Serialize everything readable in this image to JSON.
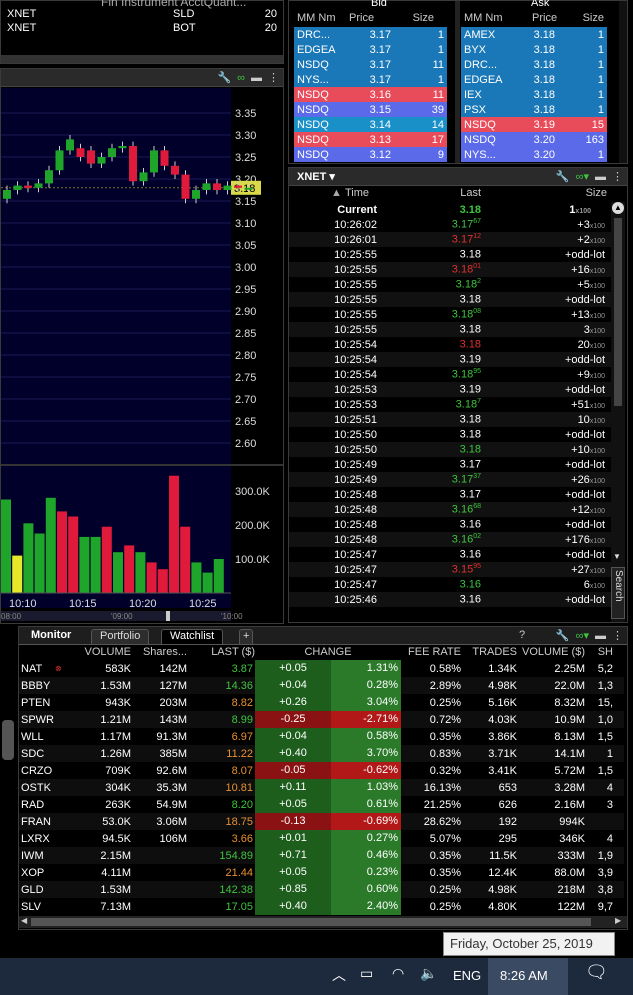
{
  "top_left": {
    "header": "Fin Instrument AcctQuant...",
    "rows": [
      {
        "sym": "XNET",
        "side": "SLD",
        "qty": "20"
      },
      {
        "sym": "XNET",
        "side": "BOT",
        "qty": "20"
      }
    ]
  },
  "book": {
    "bid_label": "Bid",
    "ask_label": "Ask",
    "col_mm": "MM Nm",
    "col_price": "Price",
    "col_size": "Size",
    "bids": [
      {
        "mm": "DRC...",
        "price": "3.17",
        "size": "1",
        "c": "#1a78b8"
      },
      {
        "mm": "EDGEA",
        "price": "3.17",
        "size": "1",
        "c": "#1a78b8"
      },
      {
        "mm": "NSDQ",
        "price": "3.17",
        "size": "11",
        "c": "#1a78b8"
      },
      {
        "mm": "NYS...",
        "price": "3.17",
        "size": "1",
        "c": "#1a78b8"
      },
      {
        "mm": "NSDQ",
        "price": "3.16",
        "size": "11",
        "c": "#e84b5a"
      },
      {
        "mm": "NSDQ",
        "price": "3.15",
        "size": "39",
        "c": "#5a6ae8"
      },
      {
        "mm": "NSDQ",
        "price": "3.14",
        "size": "14",
        "c": "#1a90c8"
      },
      {
        "mm": "NSDQ",
        "price": "3.13",
        "size": "17",
        "c": "#e84b5a"
      },
      {
        "mm": "NSDQ",
        "price": "3.12",
        "size": "9",
        "c": "#5a6ae8"
      }
    ],
    "asks": [
      {
        "mm": "AMEX",
        "price": "3.18",
        "size": "1",
        "c": "#1a78b8"
      },
      {
        "mm": "BYX",
        "price": "3.18",
        "size": "1",
        "c": "#1a78b8"
      },
      {
        "mm": "DRC...",
        "price": "3.18",
        "size": "1",
        "c": "#1a78b8"
      },
      {
        "mm": "EDGEA",
        "price": "3.18",
        "size": "1",
        "c": "#1a78b8"
      },
      {
        "mm": "IEX",
        "price": "3.18",
        "size": "1",
        "c": "#1a78b8"
      },
      {
        "mm": "PSX",
        "price": "3.18",
        "size": "1",
        "c": "#1a78b8"
      },
      {
        "mm": "NSDQ",
        "price": "3.19",
        "size": "15",
        "c": "#e84b5a"
      },
      {
        "mm": "NSDQ",
        "price": "3.20",
        "size": "163",
        "c": "#5a6ae8"
      },
      {
        "mm": "NYS...",
        "price": "3.20",
        "size": "1",
        "c": "#5a6ae8"
      }
    ]
  },
  "chart": {
    "yticks": [
      "3.35",
      "3.30",
      "3.25",
      "3.20",
      "3.15",
      "3.10",
      "3.05",
      "3.00",
      "2.95",
      "2.90",
      "2.85",
      "2.80",
      "2.75",
      "2.70",
      "2.65",
      "2.60"
    ],
    "last_price": "3.18",
    "vticks": [
      "300.0K",
      "200.0K",
      "100.0K"
    ],
    "xticks": [
      "10:10",
      "10:15",
      "10:20",
      "10:25"
    ],
    "xsub": [
      "08:00",
      "'09:00",
      "'10:00"
    ],
    "candles": [
      {
        "o": 3.155,
        "c": 3.175
      },
      {
        "o": 3.175,
        "c": 3.185
      },
      {
        "o": 3.185,
        "c": 3.18
      },
      {
        "o": 3.18,
        "c": 3.19
      },
      {
        "o": 3.19,
        "c": 3.22
      },
      {
        "o": 3.22,
        "c": 3.265
      },
      {
        "o": 3.265,
        "c": 3.29
      },
      {
        "o": 3.27,
        "c": 3.25
      },
      {
        "o": 3.265,
        "c": 3.235
      },
      {
        "o": 3.235,
        "c": 3.25
      },
      {
        "o": 3.25,
        "c": 3.27
      },
      {
        "o": 3.27,
        "c": 3.275
      },
      {
        "o": 3.275,
        "c": 3.195
      },
      {
        "o": 3.195,
        "c": 3.215
      },
      {
        "o": 3.215,
        "c": 3.265
      },
      {
        "o": 3.265,
        "c": 3.23
      },
      {
        "o": 3.23,
        "c": 3.21
      },
      {
        "o": 3.21,
        "c": 3.155
      },
      {
        "o": 3.155,
        "c": 3.175
      },
      {
        "o": 3.175,
        "c": 3.19
      },
      {
        "o": 3.19,
        "c": 3.175
      },
      {
        "o": 3.175,
        "c": 3.185
      },
      {
        "o": 3.185,
        "c": 3.18
      },
      {
        "o": 3.18,
        "c": 3.18
      }
    ],
    "volumes": [
      {
        "v": 275,
        "col": "g"
      },
      {
        "v": 110,
        "col": "y"
      },
      {
        "v": 205,
        "col": "g"
      },
      {
        "v": 175,
        "col": "g"
      },
      {
        "v": 280,
        "col": "g"
      },
      {
        "v": 240,
        "col": "r"
      },
      {
        "v": 225,
        "col": "r"
      },
      {
        "v": 165,
        "col": "g"
      },
      {
        "v": 165,
        "col": "g"
      },
      {
        "v": 195,
        "col": "r"
      },
      {
        "v": 120,
        "col": "g"
      },
      {
        "v": 140,
        "col": "r"
      },
      {
        "v": 120,
        "col": "g"
      },
      {
        "v": 90,
        "col": "r"
      },
      {
        "v": 70,
        "col": "r"
      },
      {
        "v": 345,
        "col": "r"
      },
      {
        "v": 195,
        "col": "r"
      },
      {
        "v": 90,
        "col": "g"
      },
      {
        "v": 60,
        "col": "g"
      },
      {
        "v": 100,
        "col": "g"
      }
    ]
  },
  "ts": {
    "symbol": "XNET",
    "col_time": "Time",
    "col_last": "Last",
    "col_size": "Size",
    "current_label": "Current",
    "current_last": "3.18",
    "current_size": "1",
    "x100": "x100",
    "search": "Search",
    "rows": [
      [
        "10:26:02",
        "3.17",
        "67",
        "g",
        "+3"
      ],
      [
        "10:26:01",
        "3.17",
        "12",
        "r",
        "+2"
      ],
      [
        "10:25:55",
        "3.18",
        "",
        "w",
        "+odd-lot"
      ],
      [
        "10:25:55",
        "3.18",
        "01",
        "r",
        "+16"
      ],
      [
        "10:25:55",
        "3.18",
        "2",
        "g",
        "+5"
      ],
      [
        "10:25:55",
        "3.18",
        "",
        "w",
        "+odd-lot"
      ],
      [
        "10:25:55",
        "3.18",
        "08",
        "g",
        "+13"
      ],
      [
        "10:25:55",
        "3.18",
        "",
        "w",
        "3"
      ],
      [
        "10:25:54",
        "3.18",
        "",
        "r",
        "20"
      ],
      [
        "10:25:54",
        "3.19",
        "",
        "w",
        "+odd-lot"
      ],
      [
        "10:25:54",
        "3.18",
        "95",
        "g",
        "+9"
      ],
      [
        "10:25:53",
        "3.19",
        "",
        "w",
        "+odd-lot"
      ],
      [
        "10:25:53",
        "3.18",
        "7",
        "g",
        "+51"
      ],
      [
        "10:25:51",
        "3.18",
        "",
        "w",
        "10"
      ],
      [
        "10:25:50",
        "3.18",
        "",
        "w",
        "+odd-lot"
      ],
      [
        "10:25:50",
        "3.18",
        "",
        "g",
        "+10"
      ],
      [
        "10:25:49",
        "3.17",
        "",
        "w",
        "+odd-lot"
      ],
      [
        "10:25:49",
        "3.17",
        "37",
        "g",
        "+26"
      ],
      [
        "10:25:48",
        "3.17",
        "",
        "w",
        "+odd-lot"
      ],
      [
        "10:25:48",
        "3.16",
        "68",
        "g",
        "+12"
      ],
      [
        "10:25:48",
        "3.16",
        "",
        "w",
        "+odd-lot"
      ],
      [
        "10:25:48",
        "3.16",
        "02",
        "g",
        "+176"
      ],
      [
        "10:25:47",
        "3.16",
        "",
        "w",
        "+odd-lot"
      ],
      [
        "10:25:47",
        "3.15",
        "95",
        "r",
        "+27"
      ],
      [
        "10:25:47",
        "3.16",
        "",
        "g",
        "6"
      ],
      [
        "10:25:46",
        "3.16",
        "",
        "w",
        "+odd-lot"
      ]
    ]
  },
  "monitor": {
    "tabs": [
      "Monitor",
      "Portfolio",
      "Watchlist",
      "+"
    ],
    "help": "?",
    "headers": [
      "VOLUME",
      "Shares...",
      "LAST ($)",
      "CHANGE",
      "",
      "FEE RATE",
      "TRADES",
      "VOLUME ($)",
      "SH"
    ],
    "rows": [
      [
        "NAT",
        "583K",
        "142M",
        "3.87",
        "g",
        "+0.05",
        "1.31%",
        "0.58%",
        "1.34K",
        "2.25M",
        "5,2",
        "g"
      ],
      [
        "BBBY",
        "1.53M",
        "127M",
        "14.36",
        "g",
        "+0.04",
        "0.28%",
        "2.89%",
        "4.98K",
        "22.0M",
        "1,3",
        "g"
      ],
      [
        "PTEN",
        "943K",
        "203M",
        "8.82",
        "o",
        "+0.26",
        "3.04%",
        "0.25%",
        "5.16K",
        "8.32M",
        "15,",
        "g"
      ],
      [
        "SPWR",
        "1.21M",
        "143M",
        "8.99",
        "g",
        "-0.25",
        "-2.71%",
        "0.72%",
        "4.03K",
        "10.9M",
        "1,0",
        "r"
      ],
      [
        "WLL",
        "1.17M",
        "91.3M",
        "6.97",
        "o",
        "+0.04",
        "0.58%",
        "0.35%",
        "3.86K",
        "8.13M",
        "1,5",
        "g"
      ],
      [
        "SDC",
        "1.26M",
        "385M",
        "11.22",
        "o",
        "+0.40",
        "3.70%",
        "0.83%",
        "3.71K",
        "14.1M",
        "1",
        "g"
      ],
      [
        "CRZO",
        "709K",
        "92.6M",
        "8.07",
        "o",
        "-0.05",
        "-0.62%",
        "0.32%",
        "3.41K",
        "5.72M",
        "1,5",
        "r"
      ],
      [
        "OSTK",
        "304K",
        "35.3M",
        "10.81",
        "o",
        "+0.11",
        "1.03%",
        "16.13%",
        "653",
        "3.28M",
        "4",
        "g"
      ],
      [
        "RAD",
        "263K",
        "54.9M",
        "8.20",
        "g",
        "+0.05",
        "0.61%",
        "21.25%",
        "626",
        "2.16M",
        "3",
        "g"
      ],
      [
        "FRAN",
        "53.0K",
        "3.06M",
        "18.75",
        "o",
        "-0.13",
        "-0.69%",
        "28.62%",
        "192",
        "994K",
        "",
        "r"
      ],
      [
        "LXRX",
        "94.5K",
        "106M",
        "3.66",
        "o",
        "+0.01",
        "0.27%",
        "5.07%",
        "295",
        "346K",
        "4",
        "g"
      ],
      [
        "IWM",
        "2.15M",
        "",
        "154.89",
        "g",
        "+0.71",
        "0.46%",
        "0.35%",
        "11.5K",
        "333M",
        "1,9",
        "g"
      ],
      [
        "XOP",
        "4.11M",
        "",
        "21.44",
        "o",
        "+0.05",
        "0.23%",
        "0.35%",
        "12.4K",
        "88.0M",
        "3,9",
        "g"
      ],
      [
        "GLD",
        "1.53M",
        "",
        "142.38",
        "g",
        "+0.85",
        "0.60%",
        "0.25%",
        "4.98K",
        "218M",
        "3,8",
        "g"
      ],
      [
        "SLV",
        "7.13M",
        "",
        "17.05",
        "g",
        "+0.40",
        "2.40%",
        "0.25%",
        "4.80K",
        "122M",
        "9,7",
        "g"
      ]
    ]
  },
  "taskbar": {
    "tooltip": "Friday, October 25, 2019",
    "lang": "ENG",
    "time": "8:26 AM"
  }
}
